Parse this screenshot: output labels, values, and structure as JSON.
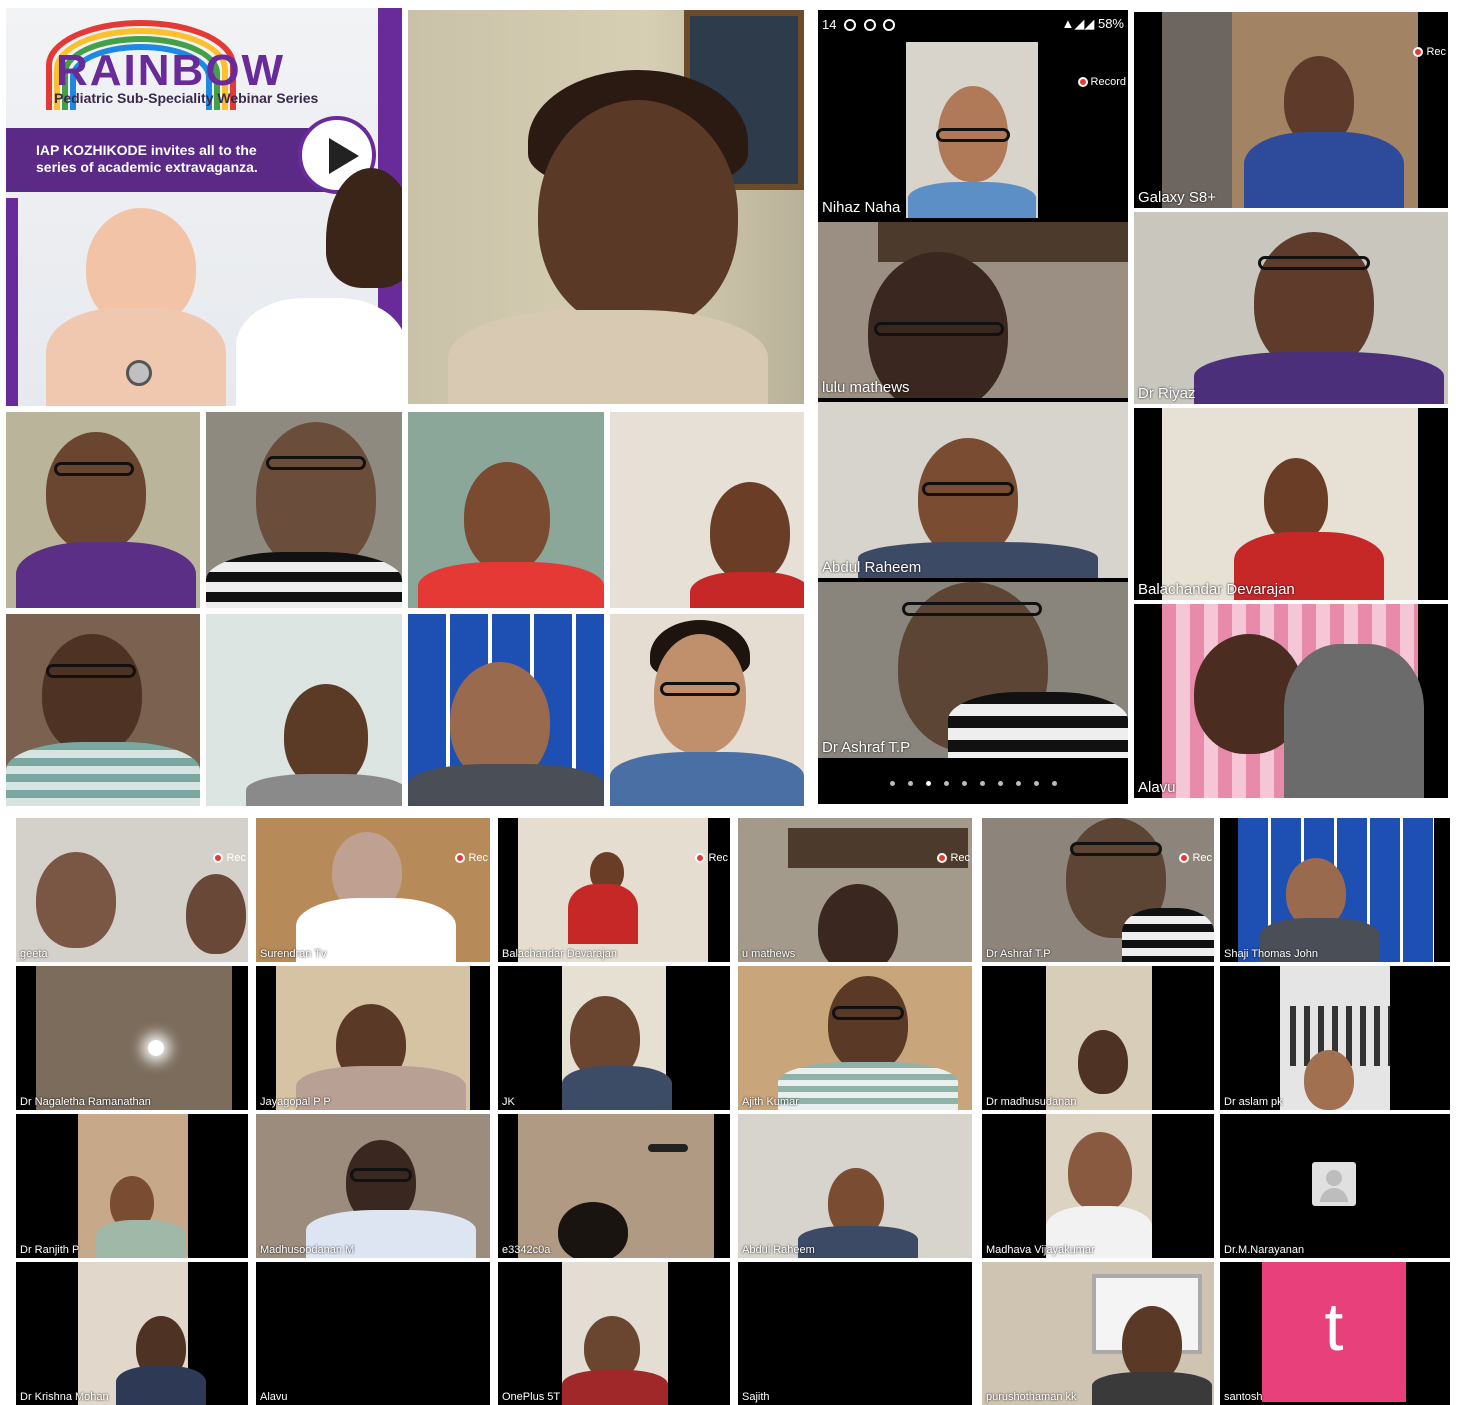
{
  "poster": {
    "logo": "RAINBOW",
    "subtitle": "Pediatric Sub-Speciality Webinar Series",
    "tagline": "IAP KOZHIKODE invites all to the series of academic extravaganza.",
    "icons": [
      "play-icon"
    ]
  },
  "phone": {
    "time": "14",
    "battery": "58%",
    "record_label": "Record",
    "participants": [
      "Nihaz Naha",
      "lulu mathews",
      "Abdul Raheem",
      "Dr Ashraf T.P"
    ],
    "pages": 10,
    "current_page": 3
  },
  "right_column": {
    "record_label": "Rec",
    "participants": [
      "Galaxy S8+",
      "Dr Riyaz",
      "Balachandar Devarajan",
      "Alavu"
    ]
  },
  "bottom_grid": {
    "record_label": "Rec",
    "tiles": [
      "geeta",
      "Surendran Tv",
      "Balachandar Devarajan",
      "u mathews",
      "Dr Ashraf T.P",
      "Shaji Thomas John",
      "Dr Nagaletha Ramanathan",
      "Jayagopal P P",
      "JK",
      "Ajith Kumar",
      "Dr madhusudanan",
      "Dr aslam pk",
      "Dr Ranjith P",
      "Madhusoodanan M",
      "e3342c0a",
      "Abdul Raheem",
      "Madhava Vijayakumar",
      "Dr.M.Narayanan",
      "Dr Krishna Mohan",
      "Alavu",
      "OnePlus 5T",
      "Sajith",
      "purushothaman kk",
      "santosh"
    ],
    "santosh_initial": "t"
  },
  "colors": {
    "poster_purple": "#6a2b9a",
    "record_red": "#e53935",
    "santosh_pink": "#e8407a",
    "bmh_blue": "#1e4fb3"
  }
}
